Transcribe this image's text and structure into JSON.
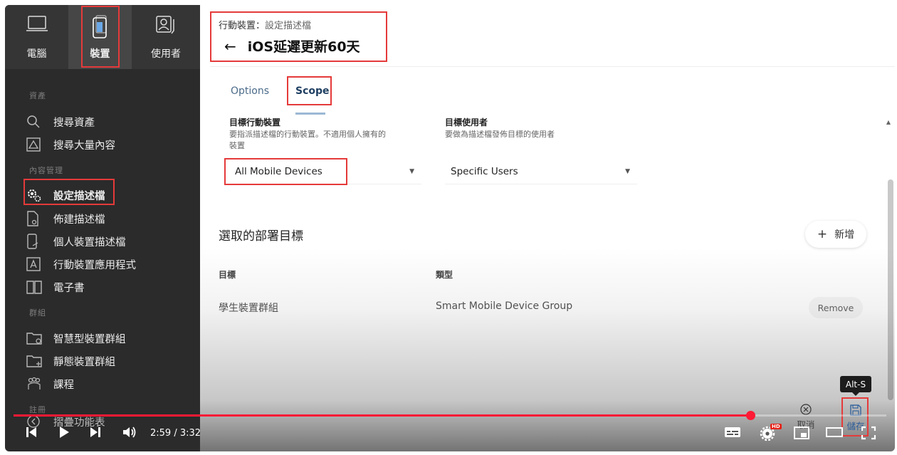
{
  "topnav": {
    "items": [
      {
        "label": "電腦",
        "icon": "laptop-icon"
      },
      {
        "label": "裝置",
        "icon": "mobile-device-icon"
      },
      {
        "label": "使用者",
        "icon": "user-id-icon"
      }
    ]
  },
  "sidebar": {
    "sections": [
      {
        "label": "資產",
        "items": [
          {
            "label": "搜尋資產",
            "icon": "search-icon"
          },
          {
            "label": "搜尋大量內容",
            "icon": "image-search-icon"
          }
        ]
      },
      {
        "label": "內容管理",
        "items": [
          {
            "label": "設定描述檔",
            "icon": "gears-icon"
          },
          {
            "label": "佈建描述檔",
            "icon": "provision-file-icon"
          },
          {
            "label": "個人裝置描述檔",
            "icon": "personal-device-icon"
          },
          {
            "label": "行動裝置應用程式",
            "icon": "app-icon"
          },
          {
            "label": "電子書",
            "icon": "book-icon"
          }
        ]
      },
      {
        "label": "群組",
        "items": [
          {
            "label": "智慧型裝置群組",
            "icon": "smart-folder-icon"
          },
          {
            "label": "靜態裝置群組",
            "icon": "static-folder-icon"
          },
          {
            "label": "課程",
            "icon": "class-icon"
          }
        ]
      },
      {
        "label": "註冊",
        "items": []
      }
    ],
    "collapse_label": "摺疊功能表"
  },
  "header": {
    "breadcrumb_parent": "行動裝置",
    "breadcrumb_sep": "：",
    "breadcrumb_current": "設定描述檔",
    "back_arrow": "←",
    "title": "iOS延遲更新60天"
  },
  "tabs": [
    {
      "label": "Options"
    },
    {
      "label": "Scope"
    }
  ],
  "scope": {
    "target_devices": {
      "label": "目標行動裝置",
      "description_line1": "要指派描述檔的行動裝置。不適用個人擁有的",
      "description_line2": "裝置",
      "value": "All Mobile Devices"
    },
    "target_users": {
      "label": "目標使用者",
      "description": "要做為描述檔發佈目標的使用者",
      "value": "Specific Users"
    },
    "selected_title": "選取的部署目標",
    "add_label": "新增",
    "columns": [
      "目標",
      "類型"
    ],
    "rows": [
      {
        "target": "學生裝置群組",
        "type": "Smart Mobile Device Group",
        "action": "Remove"
      }
    ]
  },
  "footer": {
    "cancel_label": "取消",
    "save_label": "儲存",
    "save_tooltip": "Alt-S"
  },
  "video": {
    "time": "2:59 / 3:32",
    "progress": 0.844,
    "hd_badge": "HD"
  },
  "colors": {
    "sidebar_bg": "#2b2b2b",
    "highlight": "#e53a3a",
    "progress": "#ff1a36",
    "tab_active": "#1f3f62"
  }
}
